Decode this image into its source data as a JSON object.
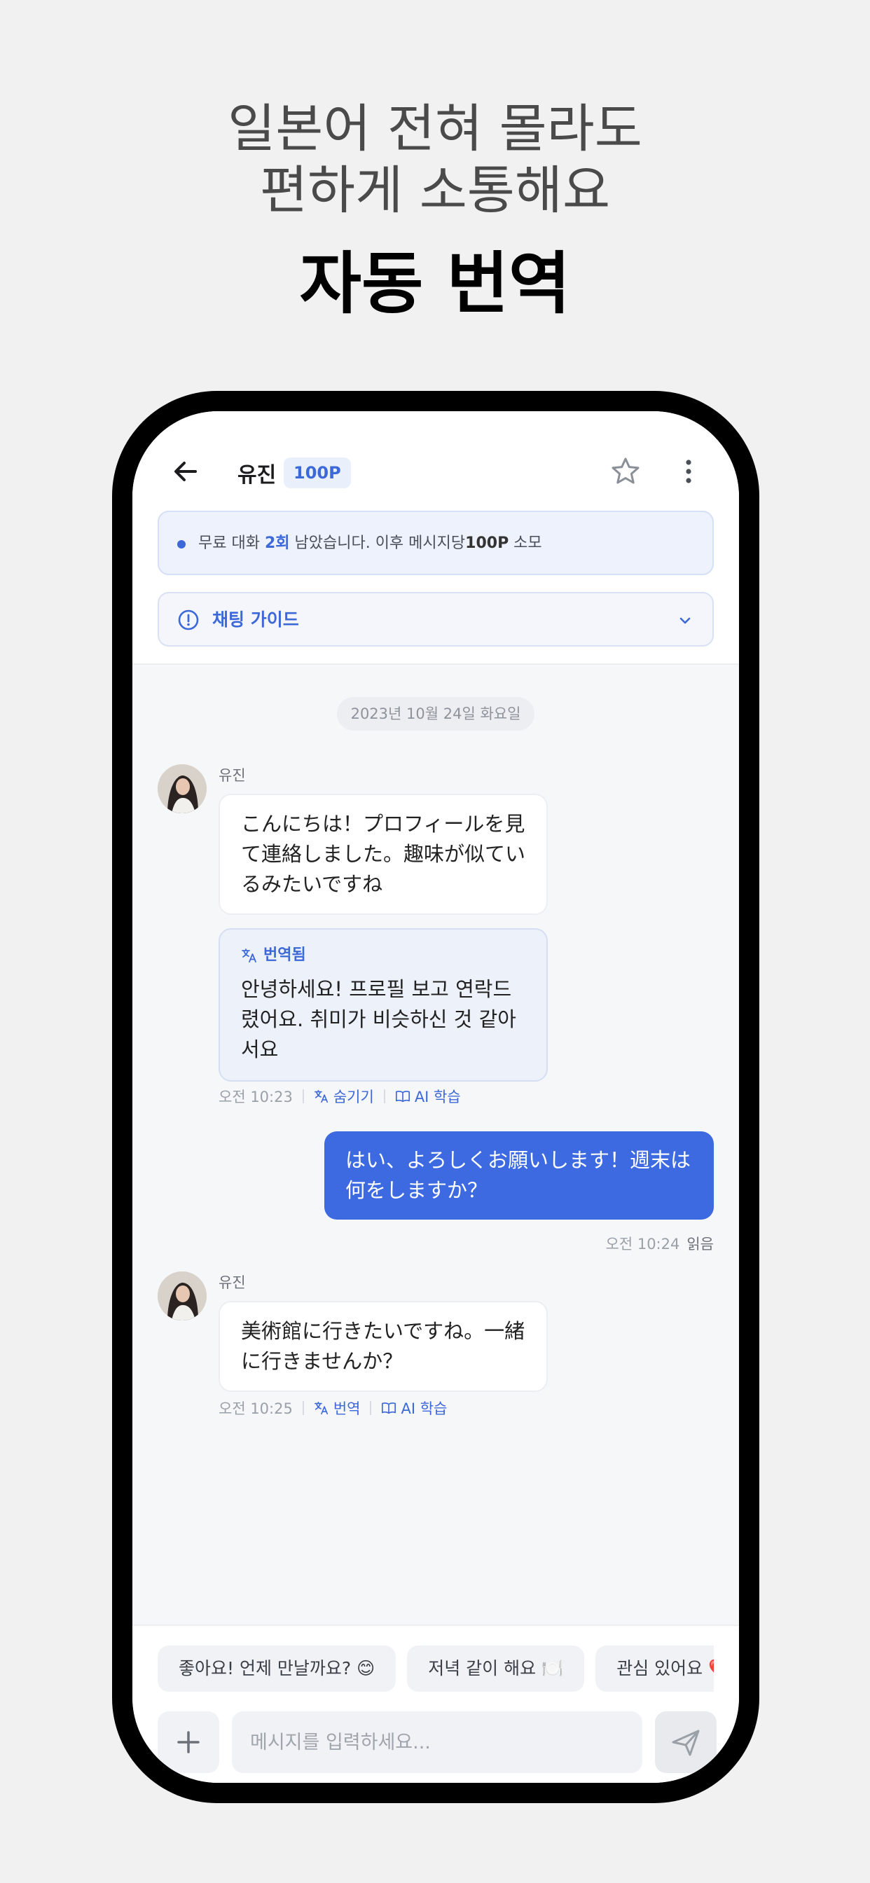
{
  "promo": {
    "subtitle_line1": "일본어 전혀 몰라도",
    "subtitle_line2": "편하게 소통해요",
    "headline": "자동 번역"
  },
  "header": {
    "title": "유진",
    "points": "100P"
  },
  "notice": {
    "prefix": "무료 대화 ",
    "count": "2회",
    "middle": " 남았습니다. 이후 메시지당",
    "cost": "100P",
    "suffix": " 소모"
  },
  "guide": {
    "label": "채팅 가이드"
  },
  "chat": {
    "date": "2023년 10월 24일 화요일",
    "messages": [
      {
        "sender": "유진",
        "text": "こんにちは！プロフィールを見て連絡しました。趣味が似ているみたいですね",
        "translation_label": "번역됨",
        "translation": "안녕하세요! 프로필 보고 연락드렸어요. 취미가 비슷하신 것 같아서요",
        "time": "오전 10:23",
        "action_translate": "숨기기",
        "action_ai": "AI 학습"
      },
      {
        "text": "はい、よろしくお願いします！週末は何をしますか？",
        "time": "오전 10:24",
        "status": "읽음"
      },
      {
        "sender": "유진",
        "text": "美術館に行きたいですね。一緒に行きませんか？",
        "time": "오전 10:25",
        "action_translate": "번역",
        "action_ai": "AI 학습"
      }
    ]
  },
  "quick_replies": [
    "좋아요! 언제 만날까요? 😊",
    "저녁 같이 해요 🍽️",
    "관심 있어요 ❤️"
  ],
  "composer": {
    "placeholder": "메시지를 입력하세요..."
  },
  "colors": {
    "accent": "#3d68d8",
    "outgoing_bubble": "#3d6ae0"
  }
}
